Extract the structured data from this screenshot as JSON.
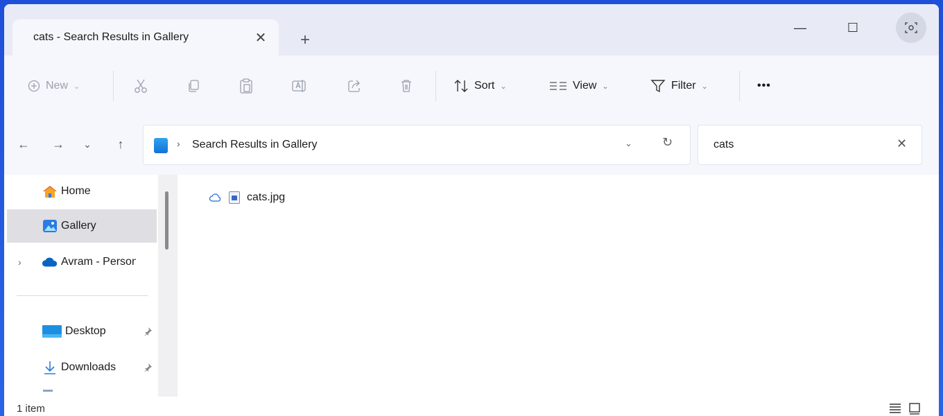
{
  "tab": {
    "title": "cats - Search Results in Gallery",
    "close_glyph": "✕",
    "new_tab_glyph": "+"
  },
  "window_controls": {
    "minimize": "—",
    "maximize": "☐",
    "extension_icon": "screen-capture-icon"
  },
  "toolbar": {
    "new_label": "New",
    "sort_label": "Sort",
    "view_label": "View",
    "filter_label": "Filter",
    "more_label": "•••",
    "icons": [
      "plus-circle-icon",
      "cut-icon",
      "copy-icon",
      "paste-icon",
      "rename-icon",
      "share-icon",
      "delete-icon",
      "sort-icon",
      "view-icon",
      "filter-icon"
    ]
  },
  "navigation": {
    "back": "←",
    "forward": "→",
    "recent": "⌄",
    "up": "↑"
  },
  "address": {
    "path": "Search Results in Gallery",
    "separator": "›",
    "dropdown": "⌄",
    "refresh": "↻"
  },
  "search": {
    "value": "cats",
    "clear": "✕"
  },
  "sidebar": {
    "items": [
      {
        "label": "Home",
        "icon": "home-icon"
      },
      {
        "label": "Gallery",
        "icon": "gallery-icon",
        "selected": true
      },
      {
        "label": "Avram - Persona",
        "icon": "onedrive-cloud-icon"
      },
      {
        "label": "Desktop",
        "icon": "desktop-icon",
        "pinned": true
      },
      {
        "label": "Downloads",
        "icon": "download-icon",
        "pinned": true
      }
    ],
    "expander": "›",
    "pin": "📌"
  },
  "content": {
    "files": [
      {
        "name": "cats.jpg",
        "status": "cloud-icon"
      }
    ]
  },
  "status": {
    "item_count": "1 item"
  },
  "colors": {
    "desktop_bg": "#2a64e6",
    "titlebar": "#e8ebf6",
    "commandbar": "#f6f7fc",
    "selected": "#dedee3"
  }
}
